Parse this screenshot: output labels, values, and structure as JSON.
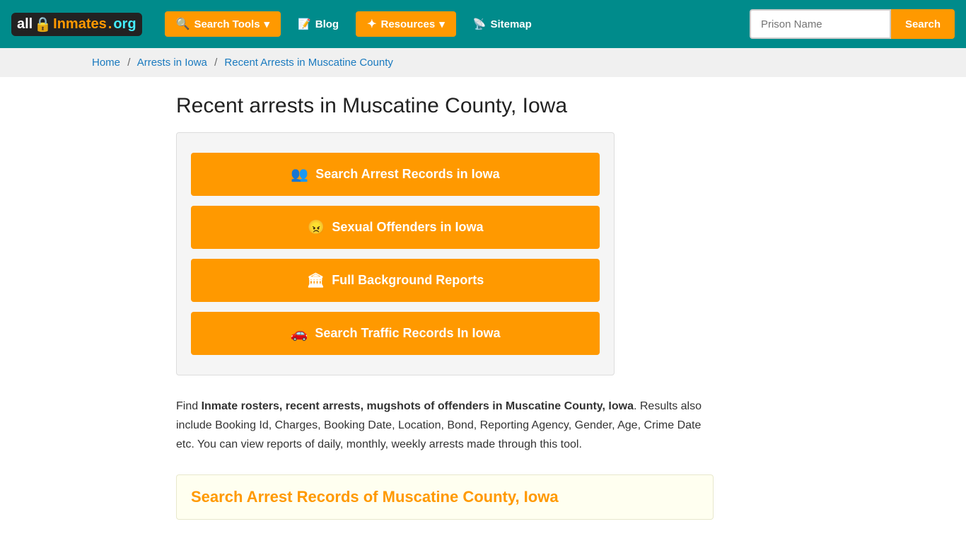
{
  "logo": {
    "text_all": "all",
    "text_inmates": "Inmates",
    "text_dot": ".",
    "text_org": "org"
  },
  "navbar": {
    "search_tools": "Search Tools",
    "blog": "Blog",
    "resources": "Resources",
    "sitemap": "Sitemap",
    "prison_placeholder": "Prison Name",
    "search_label": "Search"
  },
  "breadcrumb": {
    "home": "Home",
    "arrests_iowa": "Arrests in Iowa",
    "current": "Recent Arrests in Muscatine County"
  },
  "page": {
    "title": "Recent arrests in Muscatine County, Iowa"
  },
  "buttons": {
    "arrest_records": "Search Arrest Records in Iowa",
    "sexual_offenders": "Sexual Offenders in Iowa",
    "background_reports": "Full Background Reports",
    "traffic_records": "Search Traffic Records In Iowa"
  },
  "description": {
    "prefix": "Find ",
    "bold": "Inmate rosters, recent arrests, mugshots of offenders in Muscatine County, Iowa",
    "suffix": ". Results also include Booking Id, Charges, Booking Date, Location, Bond, Reporting Agency, Gender, Age, Crime Date etc. You can view reports of daily, monthly, weekly arrests made through this tool."
  },
  "search_section": {
    "title": "Search Arrest Records of Muscatine County, Iowa"
  }
}
